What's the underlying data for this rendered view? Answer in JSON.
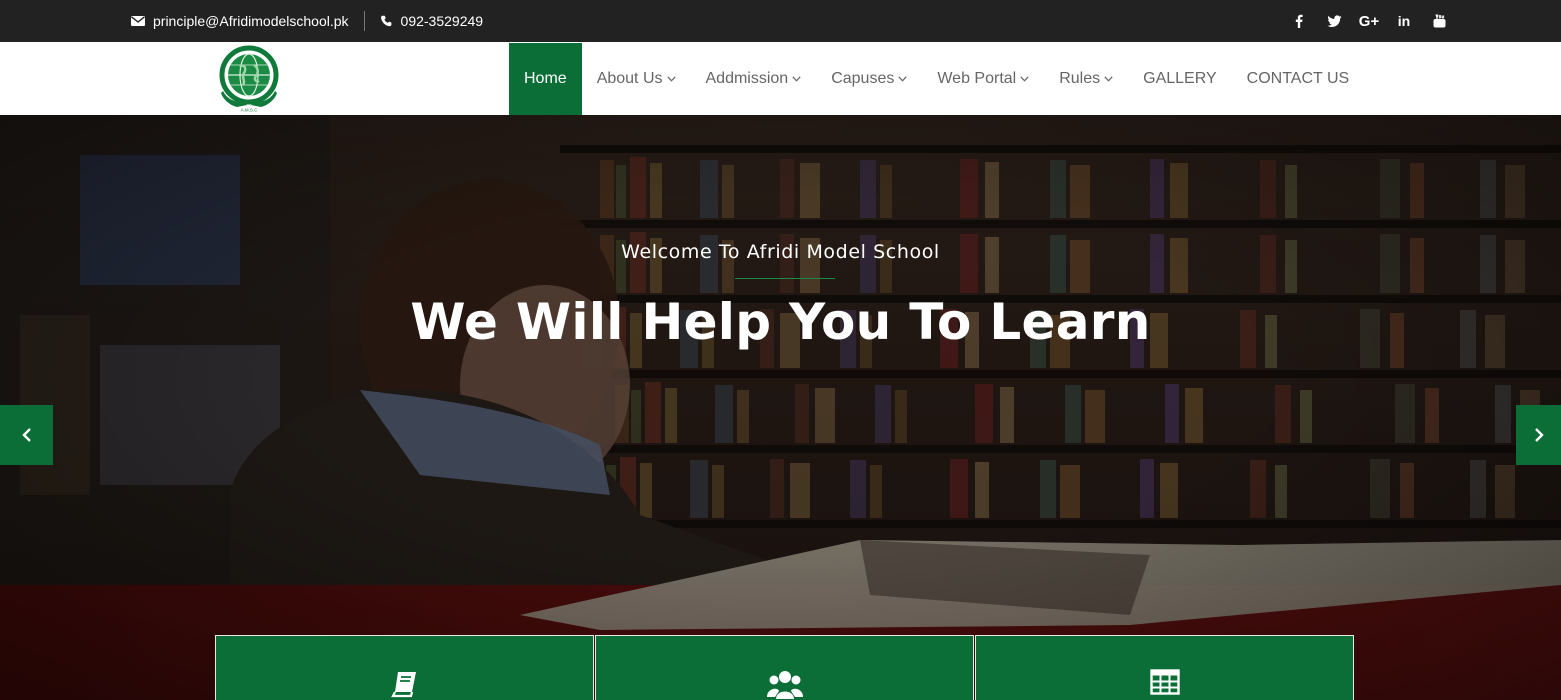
{
  "topbar": {
    "email": "principle@Afridimodelschool.pk",
    "phone": "092-3529249",
    "email_icon": "envelope-icon",
    "phone_icon": "phone-icon",
    "social": [
      {
        "name": "facebook-icon",
        "glyph": "f"
      },
      {
        "name": "twitter-icon",
        "glyph": "t"
      },
      {
        "name": "google-plus-icon",
        "glyph": "G+"
      },
      {
        "name": "linkedin-icon",
        "glyph": "in"
      },
      {
        "name": "youtube-icon",
        "glyph": "yt"
      }
    ]
  },
  "nav": {
    "logo": "school-crest-logo",
    "items": [
      {
        "label": "Home",
        "active": true,
        "dropdown": false
      },
      {
        "label": "About Us",
        "active": false,
        "dropdown": true
      },
      {
        "label": "Addmission",
        "active": false,
        "dropdown": true
      },
      {
        "label": "Capuses",
        "active": false,
        "dropdown": true
      },
      {
        "label": "Web Portal",
        "active": false,
        "dropdown": true
      },
      {
        "label": "Rules",
        "active": false,
        "dropdown": true
      },
      {
        "label": "GALLERY",
        "active": false,
        "dropdown": false
      },
      {
        "label": "CONTACT US",
        "active": false,
        "dropdown": false
      }
    ]
  },
  "hero": {
    "welcome": "Welcome To Afridi Model School",
    "headline": "We Will Help You To Learn",
    "prev_icon": "chevron-left-icon",
    "next_icon": "chevron-right-icon"
  },
  "features": [
    {
      "icon": "book-icon"
    },
    {
      "icon": "users-icon"
    },
    {
      "icon": "table-icon"
    }
  ],
  "colors": {
    "brand_green": "#0a6e36",
    "topbar_bg": "#222222",
    "nav_text": "#666666"
  }
}
